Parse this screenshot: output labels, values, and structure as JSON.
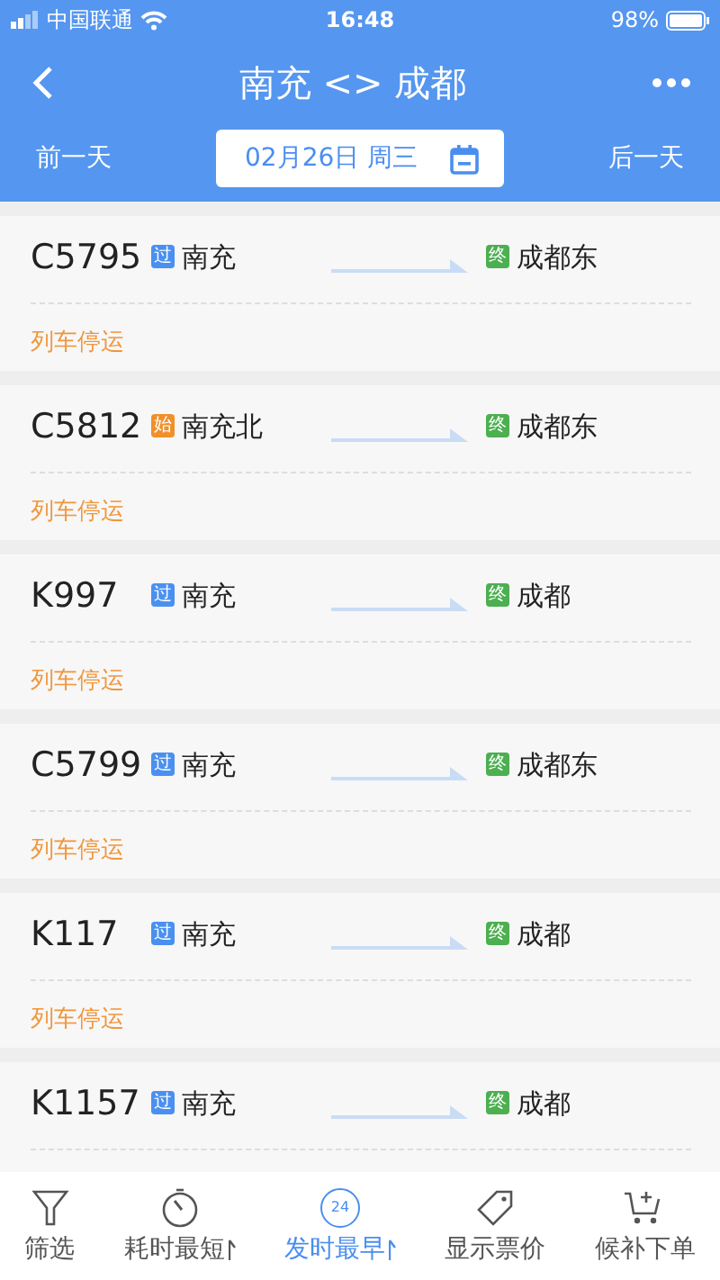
{
  "status_bar": {
    "carrier": "中国联通",
    "time": "16:48",
    "battery": "98%"
  },
  "nav": {
    "title": "南充 <> 成都"
  },
  "date_bar": {
    "prev": "前一天",
    "date": "02月26日 周三",
    "next": "后一天"
  },
  "trains": [
    {
      "number": "C5795",
      "from": {
        "kind": "pass",
        "badge": "过",
        "station": "南充"
      },
      "to": {
        "kind": "end",
        "badge": "终",
        "station": "成都东"
      },
      "status": "列车停运"
    },
    {
      "number": "C5812",
      "from": {
        "kind": "start",
        "badge": "始",
        "station": "南充北"
      },
      "to": {
        "kind": "end",
        "badge": "终",
        "station": "成都东"
      },
      "status": "列车停运"
    },
    {
      "number": "K997",
      "from": {
        "kind": "pass",
        "badge": "过",
        "station": "南充"
      },
      "to": {
        "kind": "end",
        "badge": "终",
        "station": "成都"
      },
      "status": "列车停运"
    },
    {
      "number": "C5799",
      "from": {
        "kind": "pass",
        "badge": "过",
        "station": "南充"
      },
      "to": {
        "kind": "end",
        "badge": "终",
        "station": "成都东"
      },
      "status": "列车停运"
    },
    {
      "number": "K117",
      "from": {
        "kind": "pass",
        "badge": "过",
        "station": "南充"
      },
      "to": {
        "kind": "end",
        "badge": "终",
        "station": "成都"
      },
      "status": "列车停运"
    },
    {
      "number": "K1157",
      "from": {
        "kind": "pass",
        "badge": "过",
        "station": "南充"
      },
      "to": {
        "kind": "end",
        "badge": "终",
        "station": "成都"
      }
    }
  ],
  "tab_bar": [
    {
      "kind": "filter",
      "label": "筛选",
      "selected": false
    },
    {
      "kind": "duration",
      "label": "耗时最短",
      "selected": false
    },
    {
      "kind": "departure",
      "label": "发时最早",
      "icon_text": "24",
      "selected": true
    },
    {
      "kind": "price",
      "label": "显示票价",
      "selected": false
    },
    {
      "kind": "waitlist",
      "label": "候补下单",
      "selected": false
    }
  ]
}
